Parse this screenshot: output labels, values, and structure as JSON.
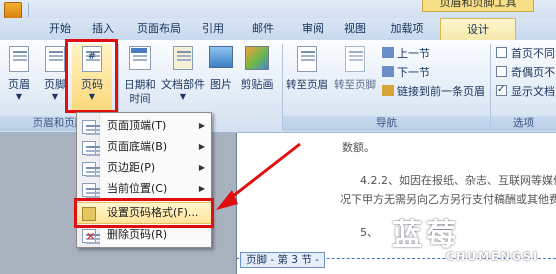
{
  "title_context": "页眉和页脚工具",
  "tabs": [
    "开始",
    "插入",
    "页面布局",
    "引用",
    "邮件",
    "审阅",
    "视图",
    "加载项",
    "设计"
  ],
  "ribbon": {
    "header_label": "页眉",
    "footer_label": "页脚",
    "page_number_label": "页码",
    "datetime_label_1": "日期和",
    "datetime_label_2": "时间",
    "docparts_label_1": "文档部件",
    "picture_label": "图片",
    "clipart_label": "剪贴画",
    "goto_header_label": "转至页眉",
    "goto_footer_label": "转至页脚",
    "prev_section_label": "上一节",
    "next_section_label": "下一节",
    "link_previous_label": "链接到前一条页眉",
    "diff_first_label": "首页不同",
    "diff_oddeven_label": "奇偶页不",
    "show_text_label": "显示文档",
    "group_hf_label": "页眉和页脚",
    "group_nav_label": "导航",
    "group_options_label": "选项"
  },
  "menu": {
    "items": [
      {
        "label": "页面顶端(T)",
        "arrow": "▶"
      },
      {
        "label": "页面底端(B)",
        "arrow": "▶"
      },
      {
        "label": "页边距(P)",
        "arrow": "▶"
      },
      {
        "label": "当前位置(C)",
        "arrow": "▶"
      },
      {
        "label": "设置页码格式(F)...",
        "arrow": ""
      },
      {
        "label": "删除页码(R)",
        "arrow": ""
      }
    ]
  },
  "document": {
    "line1": "数额。",
    "line2": "4.2.2、如因在报纸、杂志、互联网等媒体",
    "line3": "况下甲方无需另向乙方另行支付稿酬或其他费",
    "line4": "5、",
    "footer_tag": "页脚 - 第 3 节 -"
  },
  "watermark": {
    "main": "蓝莓",
    "sub": "CHUMENGSI"
  },
  "colors": {
    "highlight": "#e00f0f",
    "menu_active": "#ffe59a"
  }
}
